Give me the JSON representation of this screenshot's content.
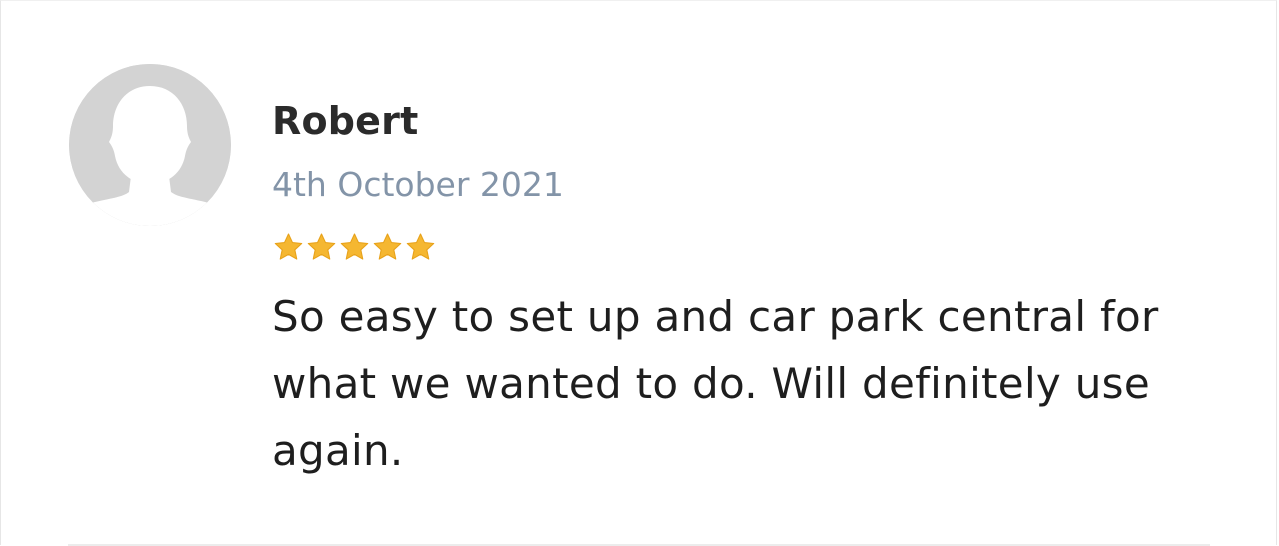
{
  "review": {
    "reviewer_name": "Robert",
    "date": "4th October 2021",
    "rating": 5,
    "max_rating": 5,
    "text": "So easy to set up and car park central for what we wanted to do. Will definitely use again."
  },
  "colors": {
    "star": "#f5b731",
    "star_stroke": "#e8a21a",
    "avatar_bg": "#d3d3d3",
    "avatar_figure": "#ffffff",
    "date": "#8394a8",
    "name": "#2b2b2b",
    "text": "#1e1e1e"
  },
  "icons": {
    "avatar": "user-silhouette-icon",
    "star": "star-icon"
  }
}
